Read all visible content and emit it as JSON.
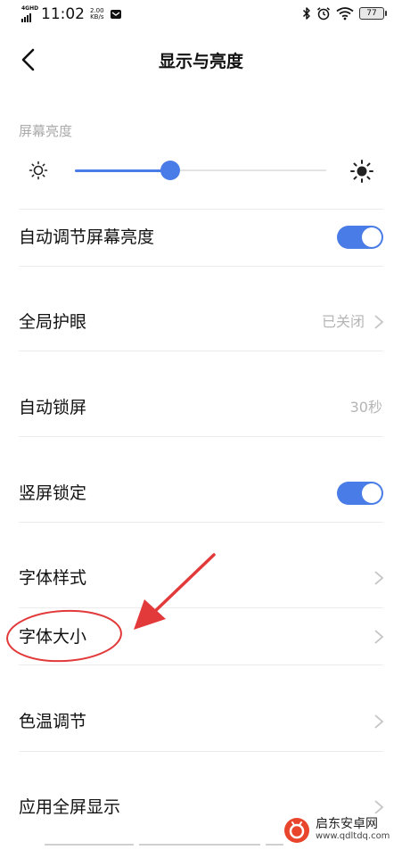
{
  "status_bar": {
    "network": "4GHD",
    "time": "11:02",
    "speed_value": "2.00",
    "speed_unit": "KB/s",
    "battery": "77"
  },
  "header": {
    "title": "显示与亮度"
  },
  "brightness": {
    "label": "屏幕亮度",
    "level_percent": 38
  },
  "settings": [
    {
      "label": "自动调节屏幕亮度",
      "control": "toggle",
      "on": true
    },
    {
      "label": "全局护眼",
      "value": "已关闭",
      "control": "chevron"
    },
    {
      "label": "自动锁屏",
      "value": "30秒",
      "control": "value"
    },
    {
      "label": "竖屏锁定",
      "control": "toggle",
      "on": true
    },
    {
      "label": "字体样式",
      "control": "chevron"
    },
    {
      "label": "字体大小",
      "control": "chevron"
    },
    {
      "label": "色温调节",
      "control": "chevron"
    },
    {
      "label": "应用全屏显示",
      "control": "chevron"
    }
  ],
  "watermark": {
    "title": "启东安卓网",
    "url": "www.qdltdq.com"
  },
  "colors": {
    "accent": "#4a7ce8",
    "annotation": "#e23a3a",
    "secondary_text": "#b5b5b5"
  }
}
